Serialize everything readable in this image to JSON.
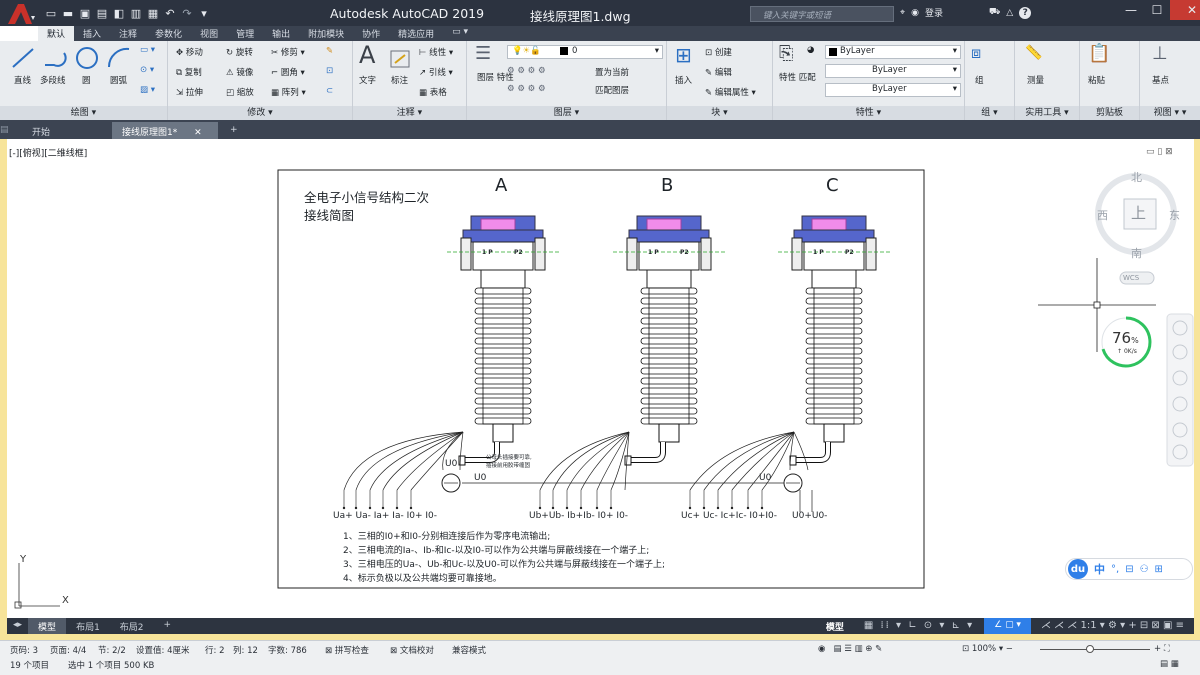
{
  "titlebar": {
    "app_title": "Autodesk AutoCAD 2019",
    "doc_name": "接线原理图1.dwg",
    "search_placeholder": "键入关键字或短语",
    "login": "登录",
    "help": "?"
  },
  "ribbon_tabs": [
    "默认",
    "插入",
    "注释",
    "参数化",
    "视图",
    "管理",
    "输出",
    "附加模块",
    "协作",
    "精选应用"
  ],
  "ribbon": {
    "draw": {
      "title": "绘图",
      "line": "直线",
      "polyline": "多段线",
      "circle": "圆",
      "arc": "圆弧"
    },
    "modify": {
      "title": "修改",
      "move": "移动",
      "rotate": "旋转",
      "trim": "修剪",
      "copy": "复制",
      "mirror": "镜像",
      "fillet": "圆角",
      "stretch": "拉伸",
      "scale": "缩放",
      "array": "阵列"
    },
    "annotation": {
      "title": "注释",
      "text": "文字",
      "dimension": "标注",
      "linear": "线性",
      "leader": "引线",
      "table": "表格"
    },
    "layers": {
      "title": "图层",
      "properties": "图层\n特性",
      "current": "0",
      "set_current": "置为当前",
      "match": "匹配图层"
    },
    "block": {
      "title": "块",
      "insert": "插入",
      "create": "创建",
      "edit": "编辑",
      "edit_attr": "编辑属性"
    },
    "properties": {
      "title": "特性",
      "match": "特性\n匹配",
      "bylayer1": "ByLayer",
      "bylayer2": "ByLayer",
      "bylayer3": "ByLayer"
    },
    "groups": {
      "title": "组",
      "group": "组"
    },
    "utilities": {
      "title": "实用工具",
      "measure": "测量"
    },
    "clipboard": {
      "title": "剪贴板",
      "paste": "粘贴"
    },
    "view": {
      "title": "视图",
      "base": "基点"
    }
  },
  "doc_tabs": {
    "start": "开始",
    "active": "接线原理图1*"
  },
  "viewport": {
    "label": "[-][俯视][二维线框]",
    "compass": {
      "n": "北",
      "s": "南",
      "e": "东",
      "w": "西",
      "top": "上",
      "wcs": "WCS"
    },
    "speed": {
      "value": "76",
      "unit": "%",
      "rate": "0K/s"
    },
    "ime": {
      "logo": "du",
      "mode": "中"
    }
  },
  "drawing": {
    "title_line1": "全电子小信号结构二次",
    "title_line2": "接线简图",
    "phases": [
      "A",
      "B",
      "C"
    ],
    "p1": "1 P",
    "p2": "P2",
    "u0": "U0",
    "note_small_1": "公母头插接要可靠,",
    "note_small_2": "插接前用胶带缠固",
    "terminals_a": "Ua+ Ua- Ia+ Ia- I0+ I0-",
    "terminals_b": "Ub+Ub- Ib+Ib- I0+ I0-",
    "terminals_c": "Uc+ Uc- Ic+Ic- I0+I0-",
    "terminals_u0": "U0+U0-",
    "notes": [
      "1、三相的I0+和I0-分别相连接后作为零序电流输出;",
      "2、三相电流的Ia-、Ib-和Ic-以及I0-可以作为公共端与屏蔽线接在一个端子上;",
      "3、三相电压的Ua-、Ub-和Uc-以及U0-可以作为公共端与屏蔽线接在一个端子上;",
      "4、标示负极以及公共端均要可靠接地。"
    ]
  },
  "layout_tabs": [
    "模型",
    "布局1",
    "布局2"
  ],
  "model_label": "模型",
  "status": {
    "page": "页码: 3",
    "pages": "页面: 4/4",
    "section": "节: 2/2",
    "setting": "设置值: 4厘米",
    "row": "行: 2",
    "col": "列: 12",
    "words": "字数: 786",
    "spell": "拼写检查",
    "proof": "文档校对",
    "compat": "兼容模式",
    "zoom": "100%",
    "scale": "1:1",
    "items": "19 个项目",
    "selected": "选中 1 个项目 500 KB"
  },
  "colors": {
    "titlebar": "#2c3340",
    "ribbon": "#e9ecef",
    "accent": "#1e90ff",
    "insulator": "#4a5a7a",
    "cap": "#5a6bd0",
    "cap_inner": "#e060d0"
  }
}
